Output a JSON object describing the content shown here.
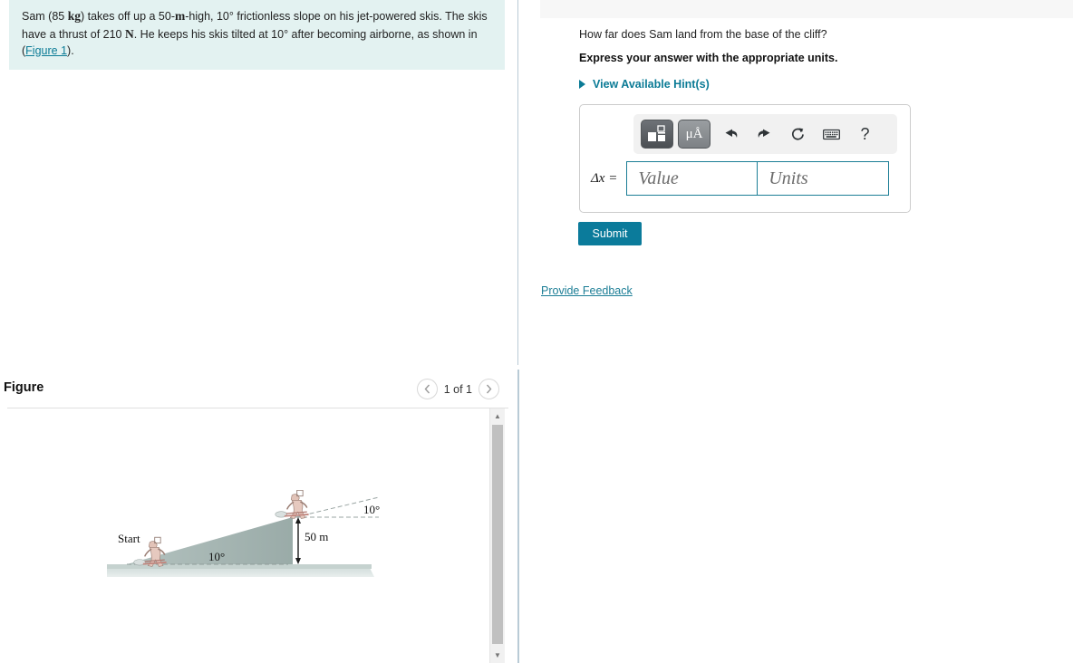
{
  "problem": {
    "line1_a": "Sam (85 ",
    "line1_unit": "kg",
    "line1_b": ") takes off up a 50-",
    "line1_unit2": "m",
    "line1_c": "-high, 10° frictionless slope on his jet-powered skis. The skis have a thrust of 210 ",
    "line1_unit3": "N",
    "line1_d": ". He keeps his skis tilted at 10° after becoming airborne, as shown in (",
    "figure_link": "Figure 1",
    "line1_e": ")."
  },
  "figure": {
    "title": "Figure",
    "pager_label": "1 of 1",
    "prev_icon": "chevron-left-icon",
    "next_icon": "chevron-right-icon",
    "illustration": {
      "start_label": "Start",
      "slope_angle": "10°",
      "launch_angle": "10°",
      "height_label": "50 m"
    }
  },
  "question": {
    "prompt": "How far does Sam land from the base of the cliff?",
    "instruction": "Express your answer with the appropriate units.",
    "hints_label": "View Available Hint(s)"
  },
  "answer": {
    "toolbar": {
      "template_button": "math-template-icon",
      "units_button": "μÅ",
      "undo_icon": "undo-icon",
      "redo_icon": "redo-icon",
      "reset_icon": "reset-icon",
      "keyboard_icon": "keyboard-icon",
      "help_label": "?"
    },
    "variable_label": "Δx =",
    "value_placeholder": "Value",
    "value": "",
    "units_placeholder": "Units",
    "units": ""
  },
  "actions": {
    "submit_label": "Submit",
    "feedback_label": "Provide Feedback"
  },
  "colors": {
    "accent": "#0b7b96",
    "submit_bg": "#0b7b9b",
    "problem_bg": "#e3f2f1",
    "input_border": "#1c7e96",
    "ramp": "#a3b4b1"
  }
}
